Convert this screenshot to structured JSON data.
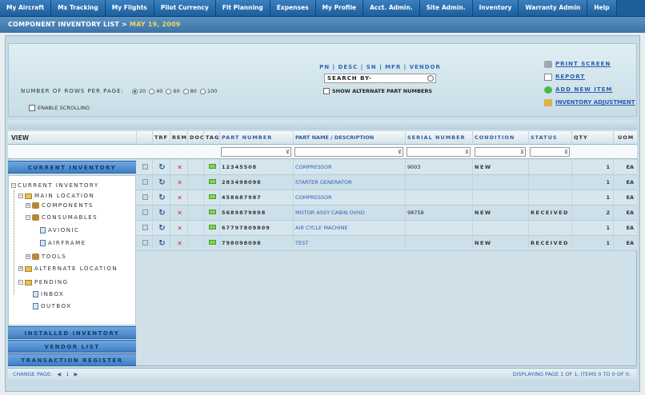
{
  "nav": [
    "My Aircraft",
    "Mx Tracking",
    "My Flights",
    "Pilot Currency",
    "Flt Planning",
    "Expenses",
    "My Profile",
    "Acct. Admin.",
    "Site Admin.",
    "Inventory",
    "Warranty Admin",
    "Help"
  ],
  "title": {
    "prefix": "COMPONENT INVENTORY LIST > ",
    "date": "MAY 19, 2009"
  },
  "rows_per_page": {
    "label": "NUMBER OF ROWS PER PAGE:",
    "options": [
      "20",
      "40",
      "60",
      "80",
      "100"
    ],
    "selected": "20"
  },
  "enable_scrolling": "ENABLE SCROLLING",
  "search": {
    "links": "PN | DESC | SN | MFR | VENDOR",
    "placeholder": "SEARCH BY-",
    "show_alt": "SHOW ALTERNATE PART NUMBERS"
  },
  "actions": {
    "print": "PRINT SCREEN",
    "report": "REPORT",
    "add": "ADD NEW ITEM",
    "adjust": "INVENTORY ADJUSTMENT"
  },
  "sidebar": {
    "view": "VIEW",
    "current_btn": "CURRENT INVENTORY",
    "tree": {
      "root": "CURRENT INVENTORY",
      "main": "MAIN LOCATION",
      "components": "COMPONENTS",
      "consumables": "CONSUMABLES",
      "avionic": "AVIONIC",
      "airframe": "AIRFRAME",
      "tools": "TOOLS",
      "alt": "ALTERNATE LOCATION",
      "pending": "PENDING",
      "inbox": "INBOX",
      "outbox": "OUTBOX"
    },
    "installed": "INSTALLED INVENTORY",
    "vendor": "VENDOR LIST",
    "transaction": "TRANSACTION REGISTER"
  },
  "table": {
    "headers": {
      "trf": "TRF",
      "rem": "REM",
      "doc": "DOC",
      "tag": "TAG",
      "part": "PART NUMBER",
      "name": "PART NAME / DESCRIPTION",
      "serial": "SERIAL NUMBER",
      "cond": "CONDITION",
      "status": "STATUS",
      "qty": "QTY",
      "uom": "UOM"
    },
    "rows": [
      {
        "part": "12345508",
        "name": "COMPRESSOR",
        "serial": "9003",
        "cond": "NEW",
        "status": "",
        "qty": "1",
        "uom": "EA"
      },
      {
        "part": "283498098",
        "name": "STARTER GENERATOR",
        "serial": "",
        "cond": "",
        "status": "",
        "qty": "1",
        "uom": "EA"
      },
      {
        "part": "458687987",
        "name": "COMPRESSOR",
        "serial": "",
        "cond": "",
        "status": "",
        "qty": "1",
        "uom": "EA"
      },
      {
        "part": "5689879898",
        "name": "MOTOR ASSY CABIN OVHD",
        "serial": "98758",
        "cond": "NEW",
        "status": "RECEIVED",
        "qty": "2",
        "uom": "EA"
      },
      {
        "part": "67797809809",
        "name": "AIR CYCLE MACHINE",
        "serial": "",
        "cond": "",
        "status": "",
        "qty": "1",
        "uom": "EA"
      },
      {
        "part": "798098098",
        "name": "TEST",
        "serial": "",
        "cond": "NEW",
        "status": "RECEIVED",
        "qty": "1",
        "uom": "EA"
      }
    ]
  },
  "footer": {
    "change": "CHANGE PAGE:",
    "prev": "◀",
    "page": "1",
    "next": "▶",
    "display": "DISPLAYING PAGE 1 OF 1, ITEMS 0 TO 0 OF 0."
  }
}
